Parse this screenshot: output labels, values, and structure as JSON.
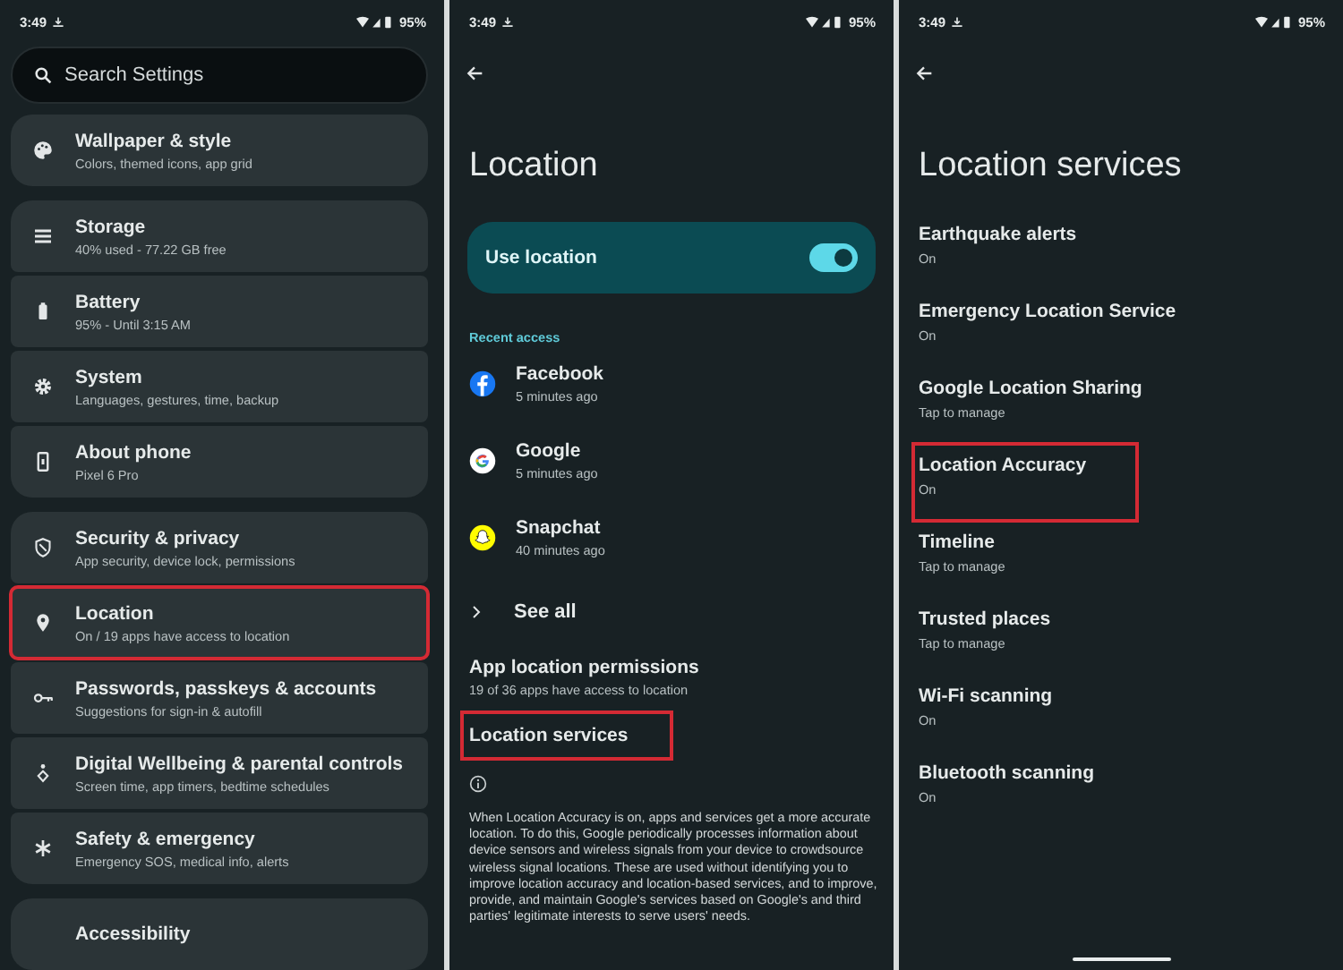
{
  "settings_screen": {
    "status_bar": {
      "time": "3:49",
      "battery": "95%"
    },
    "search": {
      "placeholder": "Search Settings"
    },
    "groups": [
      {
        "items": [
          {
            "kind": "palette",
            "title": "Wallpaper & style",
            "subtitle": "Colors, themed icons, app grid",
            "highlighted": false
          }
        ]
      },
      {
        "items": [
          {
            "kind": "storage",
            "title": "Storage",
            "subtitle": "40% used - 77.22 GB free",
            "highlighted": false
          },
          {
            "kind": "battery",
            "title": "Battery",
            "subtitle": "95% - Until 3:15 AM",
            "highlighted": false
          },
          {
            "kind": "gear",
            "title": "System",
            "subtitle": "Languages, gestures, time, backup",
            "highlighted": false
          },
          {
            "kind": "phone",
            "title": "About phone",
            "subtitle": "Pixel 6 Pro",
            "highlighted": false
          }
        ]
      },
      {
        "items": [
          {
            "kind": "shield",
            "title": "Security & privacy",
            "subtitle": "App security, device lock, permissions",
            "highlighted": false
          },
          {
            "kind": "pin",
            "title": "Location",
            "subtitle": "On / 19 apps have access to location",
            "highlighted": true
          },
          {
            "kind": "key",
            "title": "Passwords, passkeys & accounts",
            "subtitle": "Suggestions for sign-in & autofill",
            "highlighted": false
          },
          {
            "kind": "wellbeing",
            "title": "Digital Wellbeing & parental controls",
            "subtitle": "Screen time, app timers, bedtime schedules",
            "highlighted": false
          },
          {
            "kind": "asterisk",
            "title": "Safety & emergency",
            "subtitle": "Emergency SOS, medical info, alerts",
            "highlighted": false
          }
        ]
      },
      {
        "items": [
          {
            "kind": "plain",
            "title": "Accessibility",
            "highlighted": false
          }
        ]
      }
    ]
  },
  "location_screen": {
    "status_bar": {
      "time": "3:49",
      "battery": "95%"
    },
    "title": "Location",
    "use_location": {
      "label": "Use location",
      "on": true
    },
    "recent_access": {
      "heading": "Recent access",
      "apps": [
        {
          "kind": "facebook",
          "name": "Facebook",
          "time": "5 minutes ago"
        },
        {
          "kind": "google",
          "name": "Google",
          "time": "5 minutes ago"
        },
        {
          "kind": "snapchat",
          "name": "Snapchat",
          "time": "40 minutes ago"
        }
      ]
    },
    "see_all": "See all",
    "items": [
      {
        "title": "App location permissions",
        "subtitle": "19 of 36 apps have access to location",
        "highlighted": false
      },
      {
        "title": "Location services",
        "highlighted": true
      }
    ],
    "info": "When Location Accuracy is on, apps and services get a more accurate location. To do this, Google periodically processes information about device sensors and wireless signals from your device to crowdsource wireless signal locations. These are used without identifying you to improve location accuracy and location-based services, and to improve, provide, and maintain Google's services based on Google's and third parties' legitimate interests to serve users' needs."
  },
  "location_services_screen": {
    "status_bar": {
      "time": "3:49",
      "battery": "95%"
    },
    "title": "Location services",
    "items": [
      {
        "title": "Earthquake alerts",
        "subtitle": "On",
        "highlighted": false
      },
      {
        "title": "Emergency Location Service",
        "subtitle": "On",
        "highlighted": false
      },
      {
        "title": "Google Location Sharing",
        "subtitle": "Tap to manage",
        "highlighted": false
      },
      {
        "title": "Location Accuracy",
        "subtitle": "On",
        "highlighted": true
      },
      {
        "title": "Timeline",
        "subtitle": "Tap to manage",
        "highlighted": false
      },
      {
        "title": "Trusted places",
        "subtitle": "Tap to manage",
        "highlighted": false
      },
      {
        "title": "Wi-Fi scanning",
        "subtitle": "On",
        "highlighted": false
      },
      {
        "title": "Bluetooth scanning",
        "subtitle": "On",
        "highlighted": false
      }
    ]
  }
}
